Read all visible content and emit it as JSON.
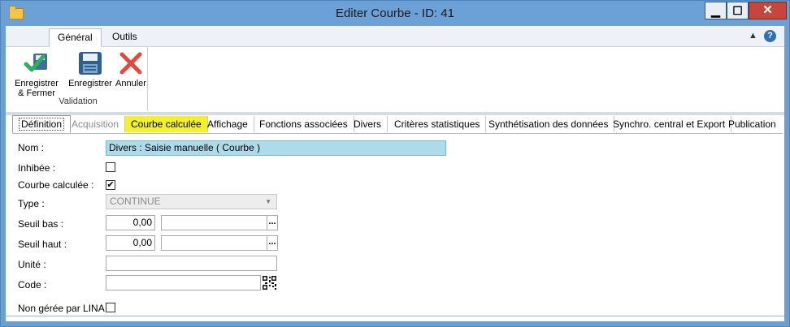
{
  "window": {
    "title": "Editer Courbe - ID: 41",
    "controls": {
      "minimize": "▁",
      "maximize": "☐",
      "close": "✕"
    }
  },
  "ribbon": {
    "tabs": [
      {
        "label": "Général",
        "active": true
      },
      {
        "label": "Outils",
        "active": false
      }
    ],
    "help_icon": "?",
    "collapse_icon": "▲",
    "buttons": {
      "save_close": "Enregistrer\n& Fermer",
      "save": "Enregistrer",
      "cancel": "Annuler"
    },
    "group_label": "Validation"
  },
  "tabs": [
    "Définition",
    "Acquisition",
    "Courbe calculée",
    "Affichage",
    "Fonctions associées",
    "Divers",
    "Critères statistiques",
    "Synthétisation des données",
    "Synchro. central et Export",
    "Publication"
  ],
  "form": {
    "nom_label": "Nom :",
    "nom_value": "Divers : Saisie manuelle ( Courbe )",
    "inhibee_label": "Inhibée :",
    "courbe_calculee_label": "Courbe calculée :",
    "type_label": "Type :",
    "type_value": "CONTINUE",
    "seuil_bas_label": "Seuil bas :",
    "seuil_bas_value": "0,00",
    "seuil_haut_label": "Seuil haut :",
    "seuil_haut_value": "0,00",
    "unite_label": "Unité :",
    "code_label": "Code :",
    "non_geree_label": "Non gérée par LINA :",
    "dots": "..."
  },
  "colors": {
    "titlebar": "#6ba1d6",
    "highlight_tab": "#f4f129",
    "nom_field": "#aedbe9",
    "close_button": "#c7463b"
  }
}
